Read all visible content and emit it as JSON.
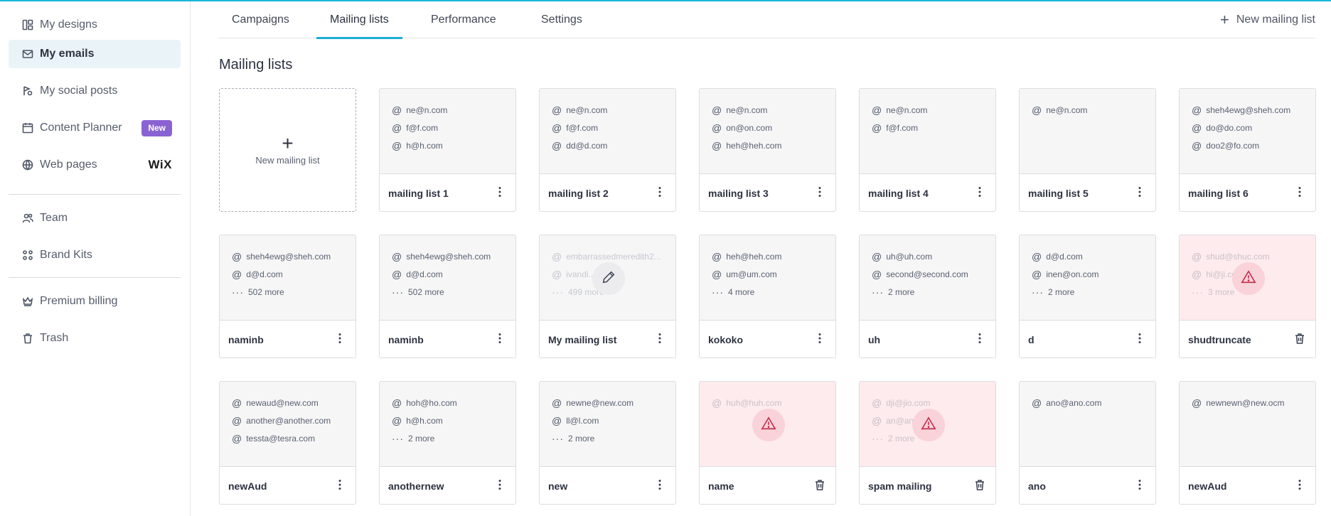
{
  "sidebar": {
    "items": [
      {
        "label": "My designs",
        "icon": "layout-icon"
      },
      {
        "label": "My emails",
        "icon": "mail-icon"
      },
      {
        "label": "My social posts",
        "icon": "social-posts-icon"
      },
      {
        "label": "Content Planner",
        "icon": "calendar-icon",
        "badge": "New"
      },
      {
        "label": "Web pages",
        "icon": "web-pages-icon",
        "brand": "WiX"
      },
      {
        "label": "Team",
        "icon": "team-icon"
      },
      {
        "label": "Brand Kits",
        "icon": "brand-kits-icon"
      },
      {
        "label": "Premium billing",
        "icon": "crown-icon"
      },
      {
        "label": "Trash",
        "icon": "trash-icon"
      }
    ]
  },
  "tabs": [
    {
      "label": "Campaigns"
    },
    {
      "label": "Mailing lists"
    },
    {
      "label": "Performance"
    },
    {
      "label": "Settings"
    }
  ],
  "header": {
    "new_list_label": "New mailing list"
  },
  "page": {
    "title": "Mailing lists",
    "new_card_label": "New mailing list"
  },
  "colors": {
    "accent": "#1aaed6",
    "badge": "#8a63d2",
    "warning": "#c0294a",
    "warning_bg": "#fdebed"
  },
  "cards": [
    {
      "name": "mailing list 1",
      "rows": [
        {
          "t": "at",
          "v": "ne@n.com"
        },
        {
          "t": "at",
          "v": "f@f.com"
        },
        {
          "t": "at",
          "v": "h@h.com"
        }
      ],
      "state": "normal",
      "action": "menu"
    },
    {
      "name": "mailing list 2",
      "rows": [
        {
          "t": "at",
          "v": "ne@n.com"
        },
        {
          "t": "at",
          "v": "f@f.com"
        },
        {
          "t": "at",
          "v": "dd@d.com"
        }
      ],
      "state": "normal",
      "action": "menu"
    },
    {
      "name": "mailing list 3",
      "rows": [
        {
          "t": "at",
          "v": "ne@n.com"
        },
        {
          "t": "at",
          "v": "on@on.com"
        },
        {
          "t": "at",
          "v": "heh@heh.com"
        }
      ],
      "state": "normal",
      "action": "menu"
    },
    {
      "name": "mailing list 4",
      "rows": [
        {
          "t": "at",
          "v": "ne@n.com"
        },
        {
          "t": "at",
          "v": "f@f.com"
        }
      ],
      "state": "normal",
      "action": "menu"
    },
    {
      "name": "mailing list 5",
      "rows": [
        {
          "t": "at",
          "v": "ne@n.com"
        }
      ],
      "state": "normal",
      "action": "menu"
    },
    {
      "name": "mailing list 6",
      "rows": [
        {
          "t": "at",
          "v": "sheh4ewg@sheh.com"
        },
        {
          "t": "at",
          "v": "do@do.com"
        },
        {
          "t": "at",
          "v": "doo2@fo.com"
        }
      ],
      "state": "normal",
      "action": "menu"
    },
    {
      "name": "naminb",
      "rows": [
        {
          "t": "at",
          "v": "sheh4ewg@sheh.com"
        },
        {
          "t": "at",
          "v": "d@d.com"
        },
        {
          "t": "more",
          "v": "502 more"
        }
      ],
      "state": "normal",
      "action": "menu"
    },
    {
      "name": "naminb",
      "rows": [
        {
          "t": "at",
          "v": "sheh4ewg@sheh.com"
        },
        {
          "t": "at",
          "v": "d@d.com"
        },
        {
          "t": "more",
          "v": "502 more"
        }
      ],
      "state": "normal",
      "action": "menu"
    },
    {
      "name": "My mailing list",
      "rows": [
        {
          "t": "at",
          "v": "embarrassedmeredith2..."
        },
        {
          "t": "at",
          "v": "ivandi...m.com"
        },
        {
          "t": "more",
          "v": "499 more"
        }
      ],
      "state": "editing",
      "action": "menu"
    },
    {
      "name": "kokoko",
      "rows": [
        {
          "t": "at",
          "v": "heh@heh.com"
        },
        {
          "t": "at",
          "v": "um@um.com"
        },
        {
          "t": "more",
          "v": "4 more"
        }
      ],
      "state": "normal",
      "action": "menu"
    },
    {
      "name": "uh",
      "rows": [
        {
          "t": "at",
          "v": "uh@uh.com"
        },
        {
          "t": "at",
          "v": "second@second.com"
        },
        {
          "t": "more",
          "v": "2 more"
        }
      ],
      "state": "normal",
      "action": "menu"
    },
    {
      "name": "d",
      "rows": [
        {
          "t": "at",
          "v": "d@d.com"
        },
        {
          "t": "at",
          "v": "inen@on.com"
        },
        {
          "t": "more",
          "v": "2 more"
        }
      ],
      "state": "normal",
      "action": "menu"
    },
    {
      "name": "shudtruncate",
      "rows": [
        {
          "t": "at",
          "v": "shud@shuc.com"
        },
        {
          "t": "at",
          "v": "hi@ji.com"
        },
        {
          "t": "more",
          "v": "3 more"
        }
      ],
      "state": "warning",
      "action": "trash"
    },
    {
      "name": "newAud",
      "rows": [
        {
          "t": "at",
          "v": "newaud@new.com"
        },
        {
          "t": "at",
          "v": "another@another.com"
        },
        {
          "t": "at",
          "v": "tessta@tesra.com"
        }
      ],
      "state": "normal",
      "action": "menu"
    },
    {
      "name": "anothernew",
      "rows": [
        {
          "t": "at",
          "v": "hoh@ho.com"
        },
        {
          "t": "at",
          "v": "h@h.com"
        },
        {
          "t": "more",
          "v": "2 more"
        }
      ],
      "state": "normal",
      "action": "menu"
    },
    {
      "name": "new",
      "rows": [
        {
          "t": "at",
          "v": "newne@new.com"
        },
        {
          "t": "at",
          "v": "ll@l.com"
        },
        {
          "t": "more",
          "v": "2 more"
        }
      ],
      "state": "normal",
      "action": "menu"
    },
    {
      "name": "name",
      "rows": [
        {
          "t": "at",
          "v": "huh@huh.com"
        }
      ],
      "state": "warning",
      "action": "trash"
    },
    {
      "name": "spam mailing",
      "rows": [
        {
          "t": "at",
          "v": "dji@jio.com"
        },
        {
          "t": "at",
          "v": "an@an.com"
        },
        {
          "t": "more",
          "v": "2 more"
        }
      ],
      "state": "warning",
      "action": "trash"
    },
    {
      "name": "ano",
      "rows": [
        {
          "t": "at",
          "v": "ano@ano.com"
        }
      ],
      "state": "normal",
      "action": "menu"
    },
    {
      "name": "newAud",
      "rows": [
        {
          "t": "at",
          "v": "newnewn@new.ocm"
        }
      ],
      "state": "normal",
      "action": "menu"
    }
  ]
}
